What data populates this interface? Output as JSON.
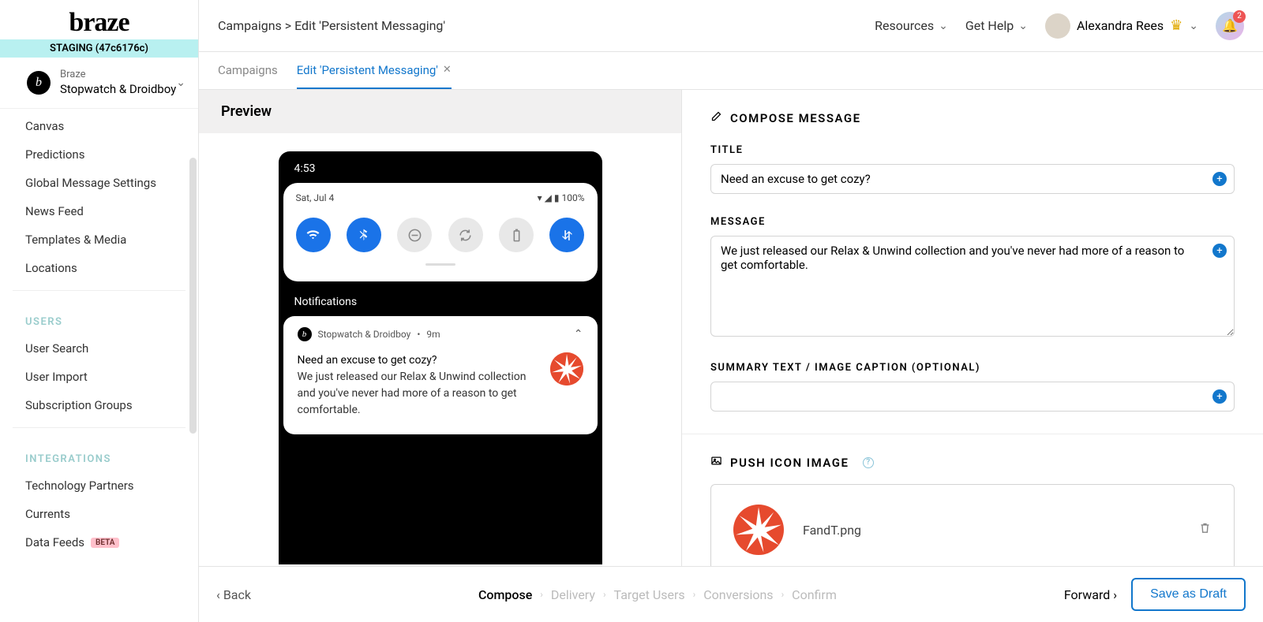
{
  "logo_text": "braze",
  "env_label": "STAGING (47c6176c)",
  "org": {
    "parent": "Braze",
    "workspace": "Stopwatch & Droidboy",
    "avatar_glyph": "b"
  },
  "sidebar": {
    "items_a": [
      "Canvas",
      "Predictions",
      "Global Message Settings",
      "News Feed",
      "Templates & Media",
      "Locations"
    ],
    "heading_users": "USERS",
    "items_users": [
      "User Search",
      "User Import",
      "Subscription Groups"
    ],
    "heading_integrations": "INTEGRATIONS",
    "items_integrations": [
      "Technology Partners",
      "Currents"
    ],
    "data_feeds": "Data Feeds",
    "beta_label": "BETA"
  },
  "breadcrumb": "Campaigns > Edit 'Persistent Messaging'",
  "top": {
    "resources": "Resources",
    "get_help": "Get Help",
    "user_name": "Alexandra Rees",
    "notif_count": "2"
  },
  "tabs": {
    "campaigns": "Campaigns",
    "edit": "Edit 'Persistent Messaging'"
  },
  "preview": {
    "header": "Preview",
    "clock": "4:53",
    "date": "Sat, Jul 4",
    "battery": "100%",
    "notif_label": "Notifications",
    "notif_app": "Stopwatch & Droidboy",
    "notif_time": "9m",
    "notif_title": "Need an excuse to get cozy?",
    "notif_body": "We just released our Relax & Unwind collection and you've never had more of a reason to get comfortable."
  },
  "compose": {
    "section": "COMPOSE MESSAGE",
    "title_label": "TITLE",
    "title_value": "Need an excuse to get cozy?",
    "message_label": "MESSAGE",
    "message_value": "We just released our Relax & Unwind collection and you've never had more of a reason to get comfortable.",
    "summary_label": "SUMMARY TEXT / IMAGE CAPTION (OPTIONAL)",
    "summary_value": "",
    "push_icon_label": "PUSH ICON IMAGE",
    "file_name": "FandT.png"
  },
  "footer": {
    "back": "Back",
    "steps": [
      "Compose",
      "Delivery",
      "Target Users",
      "Conversions",
      "Confirm"
    ],
    "forward": "Forward",
    "save": "Save as Draft"
  }
}
